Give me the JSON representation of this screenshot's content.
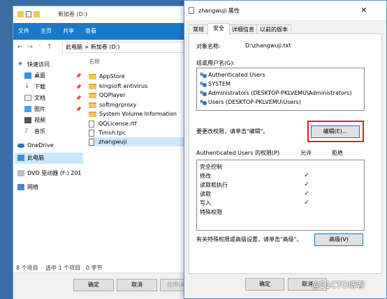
{
  "explorer": {
    "title": "新加卷 (D:)",
    "ribbon_tabs": [
      "文件",
      "主页",
      "共享",
      "查看"
    ],
    "address": "此电脑 > 新加卷 (D:)",
    "nav_items": [
      {
        "label": "快速访问",
        "icon": "star-icon"
      },
      {
        "label": "桌面",
        "icon": "desktop-icon",
        "pinned": true
      },
      {
        "label": "下载",
        "icon": "download-icon",
        "pinned": true
      },
      {
        "label": "文档",
        "icon": "document-icon",
        "pinned": true
      },
      {
        "label": "图片",
        "icon": "picture-icon",
        "pinned": true
      },
      {
        "label": "视频",
        "icon": "video-icon"
      },
      {
        "label": "音乐",
        "icon": "music-icon"
      },
      {
        "label": "OneDrive",
        "icon": "cloud-icon"
      },
      {
        "label": "此电脑",
        "icon": "computer-icon"
      },
      {
        "label": "DVD 驱动器 (F:) 201",
        "icon": "dvd-icon"
      },
      {
        "label": "网络",
        "icon": "network-icon"
      }
    ],
    "column_header": "名称",
    "files": [
      {
        "name": "AppStore",
        "type": "folder"
      },
      {
        "name": "kingsoft antivirus",
        "type": "folder"
      },
      {
        "name": "QQPlayer",
        "type": "folder"
      },
      {
        "name": "softmgrproxy",
        "type": "folder"
      },
      {
        "name": "System Volume Information",
        "type": "folder"
      },
      {
        "name": "QQLicense.rtf",
        "type": "file"
      },
      {
        "name": "Timsh.tpc",
        "type": "file"
      },
      {
        "name": "zhangwuji",
        "type": "file",
        "selected": true
      }
    ],
    "status": {
      "count": "8 个项目",
      "selected": "选中 1 个项目",
      "size": "0 字节"
    },
    "footer_buttons": [
      "确定",
      "取消",
      "应用(A)"
    ]
  },
  "props": {
    "title": "zhangwuji 属性",
    "tabs": [
      "常规",
      "安全",
      "详细信息",
      "以前的版本"
    ],
    "object_label": "对象名称:",
    "object_value": "D:\\zhangwuji.txt",
    "groups_label": "组或用户名(G):",
    "groups": [
      "Authenticated Users",
      "SYSTEM",
      "Administrators (DESKTOP-PKLVEMU\\Administrators)",
      "Users (DESKTOP-PKLVEMU\\Users)"
    ],
    "change_hint": "要更改权限，请单击\"编辑\"。",
    "edit_button": "编辑(E)...",
    "perm_title": "Authenticated Users 的权限(P)",
    "allow_header": "允许",
    "deny_header": "拒绝",
    "permissions": [
      {
        "name": "完全控制",
        "allow": ""
      },
      {
        "name": "修改",
        "allow": "✓"
      },
      {
        "name": "读取和执行",
        "allow": "✓"
      },
      {
        "name": "读取",
        "allow": "✓"
      },
      {
        "name": "写入",
        "allow": "✓"
      },
      {
        "name": "特殊权限",
        "allow": ""
      }
    ],
    "advanced_hint": "有关特殊权限或高级设置，请单击\"高级\"。",
    "advanced_button": "高级(V)",
    "footer_buttons": [
      "确定",
      "取消"
    ],
    "highlight_color": "#e0201c"
  },
  "watermark": "@51CTO博客"
}
